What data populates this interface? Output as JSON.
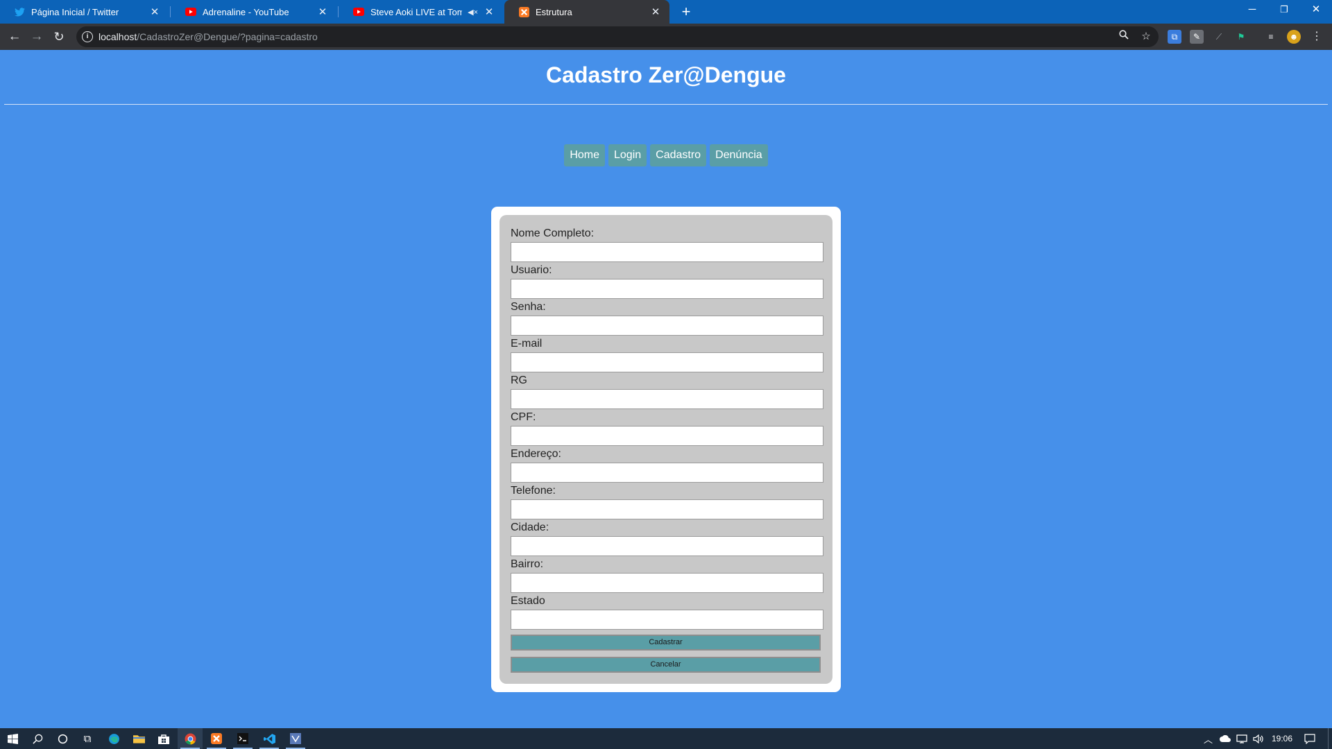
{
  "browser": {
    "tabs": [
      {
        "title": "Página Inicial / Twitter",
        "favicon": "twitter-icon",
        "active": false
      },
      {
        "title": "Adrenaline - YouTube",
        "favicon": "youtube-icon",
        "active": false
      },
      {
        "title": "Steve Aoki LIVE at Tomorrow",
        "favicon": "youtube-icon",
        "active": false,
        "muted": true
      },
      {
        "title": "Estrutura",
        "favicon": "xampp-icon",
        "active": true
      }
    ],
    "new_tab_icon": "plus-icon",
    "url_host": "localhost",
    "url_path": "/CadastroZer@Dengue/?pagina=cadastro",
    "accent": "#0c63b8",
    "toolbar_bg": "#35363a"
  },
  "page": {
    "title": "Cadastro Zer@Dengue",
    "background": "#4690ea",
    "nav": [
      {
        "label": "Home"
      },
      {
        "label": "Login"
      },
      {
        "label": "Cadastro"
      },
      {
        "label": "Denúncia"
      }
    ],
    "nav_color": "#5a9ea6",
    "form": {
      "fields": [
        {
          "label": "Nome Completo:",
          "value": ""
        },
        {
          "label": "Usuario:",
          "value": ""
        },
        {
          "label": "Senha:",
          "value": ""
        },
        {
          "label": "E-mail",
          "value": ""
        },
        {
          "label": "RG",
          "value": ""
        },
        {
          "label": "CPF:",
          "value": ""
        },
        {
          "label": "Endereço:",
          "value": ""
        },
        {
          "label": "Telefone:",
          "value": ""
        },
        {
          "label": "Cidade:",
          "value": ""
        },
        {
          "label": "Bairro:",
          "value": ""
        },
        {
          "label": "Estado",
          "value": ""
        }
      ],
      "submit_label": "Cadastrar",
      "cancel_label": "Cancelar"
    }
  },
  "taskbar": {
    "clock": "19:06",
    "apps": [
      "windows-start-icon",
      "search-icon",
      "cortana-icon",
      "task-view-icon",
      "edge-icon",
      "file-explorer-icon",
      "store-icon",
      "chrome-icon",
      "xampp-icon",
      "terminal-icon",
      "vscode-icon",
      "app-icon"
    ]
  }
}
